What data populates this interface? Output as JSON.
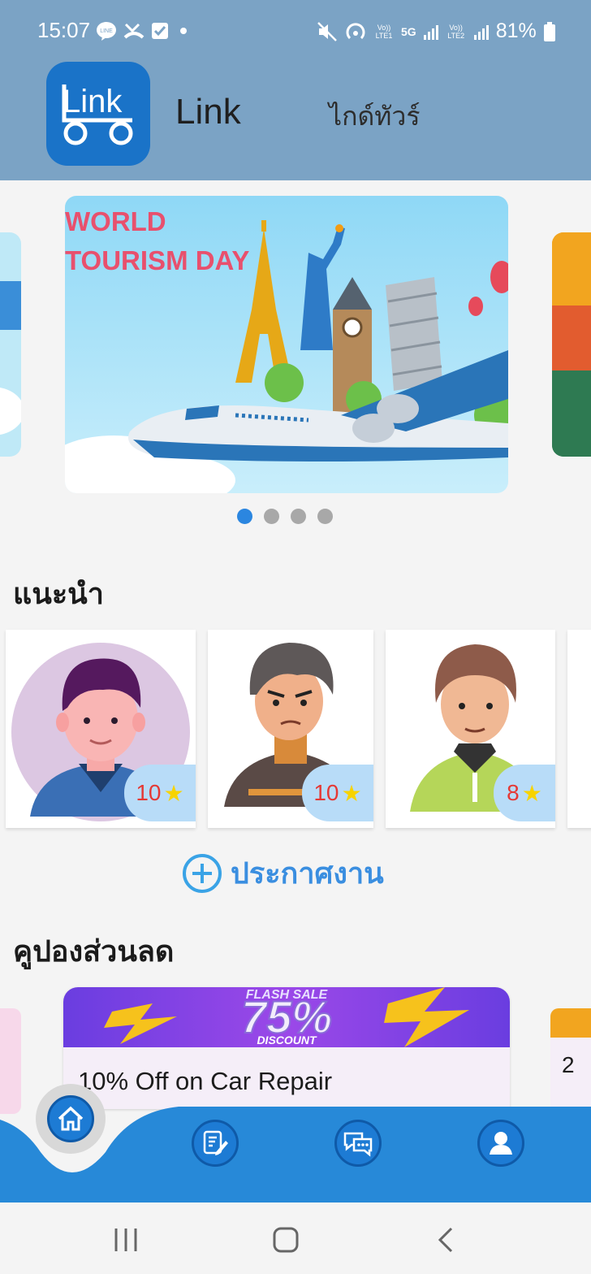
{
  "status_bar": {
    "time": "15:07",
    "battery": "81%",
    "left_icons": [
      "line-icon",
      "missed-call-icon",
      "checkbox-icon",
      "dot-icon"
    ],
    "right_icons": [
      "mute-icon",
      "hotspot-icon",
      "volte-lte1-icon",
      "5g-icon",
      "signal-icon",
      "volte-lte2-icon",
      "signal-icon",
      "battery-icon"
    ],
    "volte1": "Vo)) LTE1",
    "volte2": "Vo)) LTE2",
    "five_g": "5G"
  },
  "header": {
    "logo_text": "Link",
    "app_name": "Link",
    "nav_link": "ไกด์ทัวร์"
  },
  "carousel": {
    "banner_title_line1": "WORLD",
    "banner_title_line2": "TOURISM DAY",
    "slide_count": 4,
    "active_index": 0
  },
  "recommended": {
    "title": "แนะนำ",
    "guides": [
      {
        "rating": "10",
        "star": "★"
      },
      {
        "rating": "10",
        "star": "★"
      },
      {
        "rating": "8",
        "star": "★"
      }
    ]
  },
  "post_job": {
    "label": "ประกาศงาน"
  },
  "coupons": {
    "title": "คูปองส่วนลด",
    "banner_text": "75%",
    "banner_sub": "DISCOUNT",
    "banner_top": "FLASH SALE",
    "items": [
      {
        "title": "10% Off on Car Repair"
      }
    ],
    "next_peek": "2"
  },
  "bottom_nav": {
    "items": [
      "home-icon",
      "post-icon",
      "chat-icon",
      "profile-icon"
    ],
    "active": "home-icon"
  },
  "colors": {
    "header_bg": "#7ba3c5",
    "accent": "#1d7bd4",
    "rating_text": "#e53935",
    "star": "#f7d300"
  }
}
